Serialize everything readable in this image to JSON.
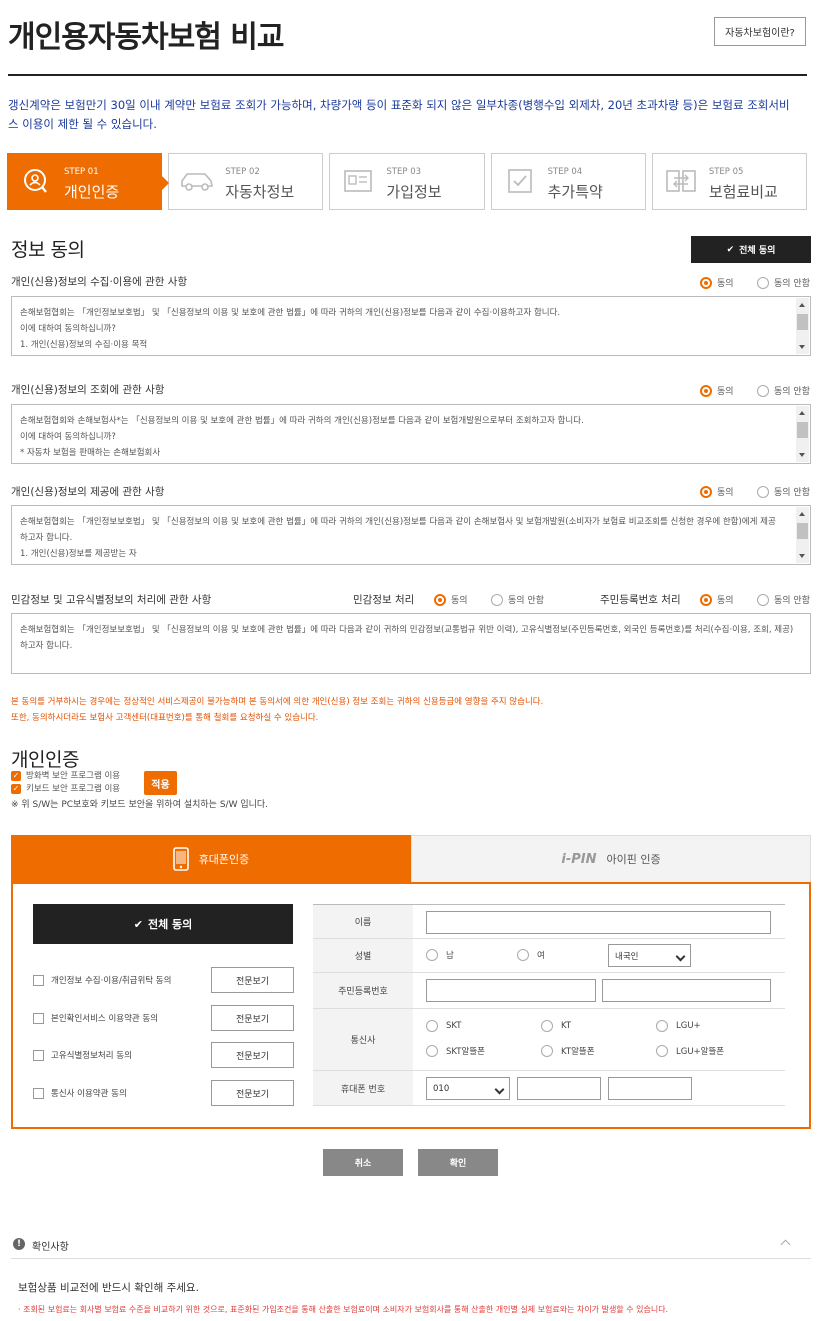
{
  "header": {
    "title": "개인용자동차보험 비교",
    "help_button": "자동차보험이란?"
  },
  "notice": "갱신계약은 보험만기 30일 이내 계약만 보험료 조회가 가능하며, 차량가액 등이 표준화 되지 않은 일부차종(병행수입 외제차, 20년 초과차량 등)은 보험료 조회서비스 이용이 제한 될 수 있습니다.",
  "steps": [
    {
      "num": "STEP 01",
      "label": "개인인증",
      "icon": "person-search-icon",
      "active": true
    },
    {
      "num": "STEP 02",
      "label": "자동차정보",
      "icon": "car-icon",
      "active": false
    },
    {
      "num": "STEP 03",
      "label": "가입정보",
      "icon": "id-card-icon",
      "active": false
    },
    {
      "num": "STEP 04",
      "label": "추가특약",
      "icon": "checkbox-icon",
      "active": false
    },
    {
      "num": "STEP 05",
      "label": "보험료비교",
      "icon": "compare-icon",
      "active": false
    }
  ],
  "consent": {
    "title": "정보 동의",
    "agree_all": "전체 동의",
    "agree": "동의",
    "disagree": "동의 안함",
    "sections": [
      {
        "label": "개인(신용)정보의 수집·이용에 관한 사항",
        "lines": [
          "손해보험협회는 「개인정보보호법」 및 「신용정보의 이용 및 보호에 관한 법률」에 따라 귀하의 개인(신용)정보를 다음과 같이 수집·이용하고자 합니다.",
          "이에 대하여 동의하십니까?",
          "1. 개인(신용)정보의 수집·이용 목적"
        ]
      },
      {
        "label": "개인(신용)정보의 조회에 관한 사항",
        "lines": [
          "손해보험협회와 손해보험사*는 「신용정보의 이용 및 보호에 관한 법률」에 따라 귀하의 개인(신용)정보를 다음과 같이 보험개발원으로부터 조회하고자 합니다.",
          "이에 대하여 동의하십니까?",
          "* 자동차 보험을 판매하는 손해보험회사"
        ]
      },
      {
        "label": "개인(신용)정보의 제공에 관한 사항",
        "lines": [
          "손해보험협회는 「개인정보보호법」 및 「신용정보의 이용 및 보호에 관한 법률」에 따라 귀하의 개인(신용)정보를 다음과 같이 손해보험사 및 보험개발원(소비자가 보험료 비교조회를 신청한 경우에 한함)에게 제공",
          "하고자 합니다.",
          "1. 개인(신용)정보를 제공받는 자"
        ]
      }
    ],
    "sensitive": {
      "label": "민감정보 및 고유식별정보의 처리에 관한 사항",
      "sub1": "민감정보 처리",
      "sub2": "주민등록번호 처리",
      "lines": [
        "손해보험협회는 「개인정보보호법」 및 「신용정보의 이용 및 보호에 관한 법률」에 따라 다음과 같이 귀하의 민감정보(교통법규 위반 이력), 고유식별정보(주민등록번호, 외국인 등록번호)를 처리(수집·이용, 조회, 제공)",
        "하고자 합니다."
      ]
    },
    "warnings": [
      "본 동의를 거부하시는 경우에는 정상적인 서비스제공이 불가능하며 본 동의서에 의한 개인(신용) 정보 조회는 귀하의 신용등급에 영향을 주지 않습니다.",
      "또한, 동의하시더라도 보험사 고객센터(대표번호)를 통해 철회를 요청하실 수 있습니다."
    ]
  },
  "auth": {
    "title": "개인인증",
    "programs": [
      "방화벽 보안 프로그램 이용",
      "키보드 보안 프로그램 이용"
    ],
    "apply": "적용",
    "sw_note": "※ 위 S/W는 PC보호와 키보드 보안을 위하여 설치하는 S/W 입니다.",
    "tab_phone": "휴대폰인증",
    "tab_ipin_logo": "i-PIN",
    "tab_ipin": "아이핀 인증",
    "agree_all": "전체 동의",
    "view_full": "전문보기",
    "agreements": [
      "개인정보 수집·이용/취급위탁 동의",
      "본인확인서비스 이용약관 동의",
      "고유식별정보처리 동의",
      "통신사 이용약관 동의"
    ],
    "form": {
      "name_label": "이름",
      "gender_label": "성별",
      "male": "남",
      "female": "여",
      "nationality": "내국인",
      "rrn_label": "주민등록번호",
      "carrier_label": "통신사",
      "carriers": [
        "SKT",
        "KT",
        "LGU+",
        "SKT알뜰폰",
        "KT알뜰폰",
        "LGU+알뜰폰"
      ],
      "phone_label": "휴대폰 번호",
      "phone_prefix": "010"
    },
    "cancel": "취소",
    "confirm": "확인"
  },
  "footer": {
    "check_title": "확인사항",
    "text": "보험상품 비교전에 반드시 확인해 주세요.",
    "note": "· 조회된 보험료는 회사별 보험료 수준을 비교하기 위한 것으로, 표준화된 가입조건을 통해 산출한 보험료이며 소비자가 보험회사를 통해 산출한 개인별 실제 보험료와는 차이가 발생할 수 있습니다."
  },
  "colors": {
    "accent": "#ef6c00",
    "notice_blue": "#1a3a9a",
    "dark_button": "#222222"
  }
}
